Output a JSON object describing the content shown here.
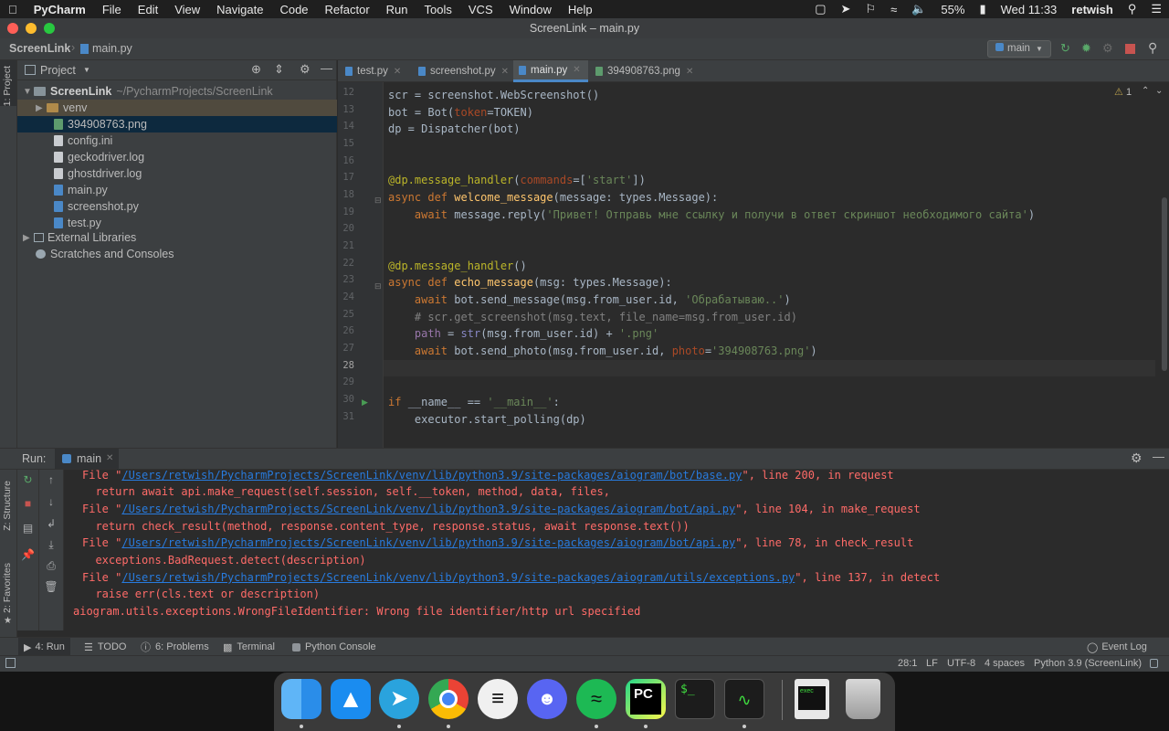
{
  "menubar": {
    "apple": "",
    "app_name": "PyCharm",
    "items": [
      "File",
      "Edit",
      "View",
      "Navigate",
      "Code",
      "Refactor",
      "Run",
      "Tools",
      "VCS",
      "Window",
      "Help"
    ],
    "battery": "55%",
    "clock": "Wed 11:33",
    "user": "retwish"
  },
  "window": {
    "title": "ScreenLink – main.py"
  },
  "navbar": {
    "project": "ScreenLink",
    "file": "main.py",
    "run_config": "main"
  },
  "sidebar_tools": {
    "project": "1: Project",
    "structure": "Z: Structure",
    "favorites": "2: Favorites"
  },
  "project_panel": {
    "title": "Project",
    "root": {
      "name": "ScreenLink",
      "path": "~/PycharmProjects/ScreenLink"
    },
    "items": [
      {
        "name": "venv",
        "type": "folder"
      },
      {
        "name": "394908763.png",
        "type": "image"
      },
      {
        "name": "config.ini",
        "type": "file"
      },
      {
        "name": "geckodriver.log",
        "type": "file"
      },
      {
        "name": "ghostdriver.log",
        "type": "file"
      },
      {
        "name": "main.py",
        "type": "py"
      },
      {
        "name": "screenshot.py",
        "type": "py"
      },
      {
        "name": "test.py",
        "type": "py"
      }
    ],
    "external": "External Libraries",
    "scratches": "Scratches and Consoles"
  },
  "tabs": [
    {
      "label": "test.py",
      "active": false
    },
    {
      "label": "screenshot.py",
      "active": false
    },
    {
      "label": "main.py",
      "active": true
    },
    {
      "label": "394908763.png",
      "active": false
    }
  ],
  "editor": {
    "warnings": "1",
    "line_numbers": [
      "12",
      "13",
      "14",
      "15",
      "16",
      "17",
      "18",
      "19",
      "20",
      "21",
      "22",
      "23",
      "24",
      "25",
      "26",
      "27",
      "28",
      "29",
      "30",
      "31"
    ]
  },
  "run_panel": {
    "label": "Run:",
    "config": "main",
    "lines": {
      "l1_pre": "File \"",
      "l1_link": "/Users/retwish/PycharmProjects/ScreenLink/venv/lib/python3.9/site-packages/aiogram/bot/base.py",
      "l1_post": "\", line 200, in request",
      "l2": "  return await api.make_request(self.session, self.__token, method, data, files,",
      "l3_pre": "File \"",
      "l3_link": "/Users/retwish/PycharmProjects/ScreenLink/venv/lib/python3.9/site-packages/aiogram/bot/api.py",
      "l3_post": "\", line 104, in make_request",
      "l4": "  return check_result(method, response.content_type, response.status, await response.text())",
      "l5_pre": "File \"",
      "l5_link": "/Users/retwish/PycharmProjects/ScreenLink/venv/lib/python3.9/site-packages/aiogram/bot/api.py",
      "l5_post": "\", line 78, in check_result",
      "l6": "  exceptions.BadRequest.detect(description)",
      "l7_pre": "File \"",
      "l7_link": "/Users/retwish/PycharmProjects/ScreenLink/venv/lib/python3.9/site-packages/aiogram/utils/exceptions.py",
      "l7_post": "\", line 137, in detect",
      "l8": "  raise err(cls.text or description)",
      "l9": "aiogram.utils.exceptions.WrongFileIdentifier: Wrong file identifier/http url specified"
    }
  },
  "bottom_tabs": {
    "run": "4: Run",
    "todo": "TODO",
    "problems": "6: Problems",
    "terminal": "Terminal",
    "python_console": "Python Console",
    "event_log": "Event Log"
  },
  "status": {
    "position": "28:1",
    "line_sep": "LF",
    "encoding": "UTF-8",
    "indent": "4 spaces",
    "interpreter": "Python 3.9 (ScreenLink)"
  },
  "dock": {
    "pycharm_label": "PC",
    "terminal_label": "$_",
    "exec_label": "exec",
    "apps": [
      "finder",
      "app-store",
      "telegram",
      "chrome",
      "amplitude",
      "discord",
      "spotify",
      "pycharm",
      "terminal",
      "activity-monitor",
      "exec",
      "trash"
    ]
  }
}
